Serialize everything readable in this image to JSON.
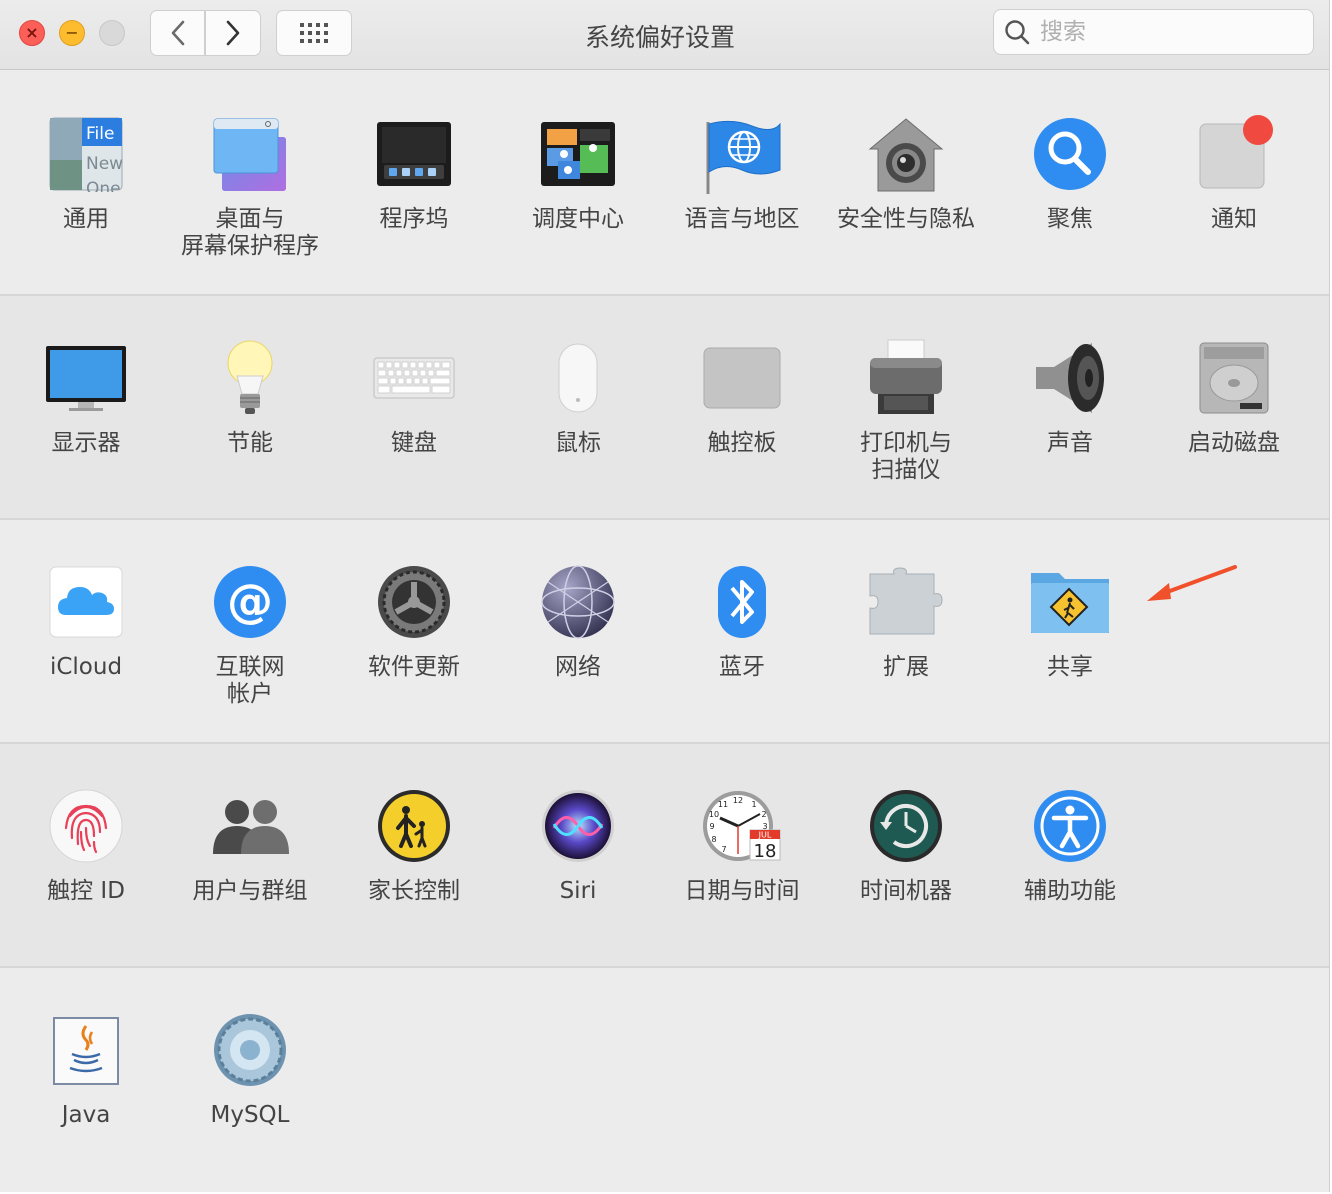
{
  "window": {
    "title": "系统偏好设置",
    "close_glyph": "×",
    "minimize_glyph": "−"
  },
  "toolbar": {
    "back_icon": "chevron-left-icon",
    "forward_icon": "chevron-right-icon",
    "grid_icon": "grid-icon",
    "search_placeholder": "搜索"
  },
  "rows": [
    {
      "items": [
        {
          "label": "通用",
          "icon": "general-icon",
          "icon_text": [
            "File",
            "New",
            "One"
          ]
        },
        {
          "label": "桌面与\n屏幕保护程序",
          "icon": "desktop-screensaver-icon"
        },
        {
          "label": "程序坞",
          "icon": "dock-icon"
        },
        {
          "label": "调度中心",
          "icon": "mission-control-icon"
        },
        {
          "label": "语言与地区",
          "icon": "language-region-icon"
        },
        {
          "label": "安全性与隐私",
          "icon": "security-privacy-icon"
        },
        {
          "label": "聚焦",
          "icon": "spotlight-icon"
        },
        {
          "label": "通知",
          "icon": "notifications-icon"
        }
      ]
    },
    {
      "items": [
        {
          "label": "显示器",
          "icon": "displays-icon"
        },
        {
          "label": "节能",
          "icon": "energy-saver-icon"
        },
        {
          "label": "键盘",
          "icon": "keyboard-icon"
        },
        {
          "label": "鼠标",
          "icon": "mouse-icon"
        },
        {
          "label": "触控板",
          "icon": "trackpad-icon"
        },
        {
          "label": "打印机与\n扫描仪",
          "icon": "printers-scanners-icon"
        },
        {
          "label": "声音",
          "icon": "sound-icon"
        },
        {
          "label": "启动磁盘",
          "icon": "startup-disk-icon"
        }
      ]
    },
    {
      "items": [
        {
          "label": "iCloud",
          "icon": "icloud-icon"
        },
        {
          "label": "互联网\n帐户",
          "icon": "internet-accounts-icon"
        },
        {
          "label": "软件更新",
          "icon": "software-update-icon"
        },
        {
          "label": "网络",
          "icon": "network-icon"
        },
        {
          "label": "蓝牙",
          "icon": "bluetooth-icon"
        },
        {
          "label": "扩展",
          "icon": "extensions-icon"
        },
        {
          "label": "共享",
          "icon": "sharing-icon"
        }
      ]
    },
    {
      "items": [
        {
          "label": "触控 ID",
          "icon": "touch-id-icon"
        },
        {
          "label": "用户与群组",
          "icon": "users-groups-icon"
        },
        {
          "label": "家长控制",
          "icon": "parental-controls-icon"
        },
        {
          "label": "Siri",
          "icon": "siri-icon"
        },
        {
          "label": "日期与时间",
          "icon": "date-time-icon",
          "icon_text": [
            "JUL",
            "18"
          ]
        },
        {
          "label": "时间机器",
          "icon": "time-machine-icon"
        },
        {
          "label": "辅助功能",
          "icon": "accessibility-icon"
        }
      ]
    },
    {
      "items": [
        {
          "label": "Java",
          "icon": "java-icon"
        },
        {
          "label": "MySQL",
          "icon": "mysql-icon"
        }
      ]
    }
  ],
  "annotation": {
    "icon": "red-arrow-icon",
    "color": "#f0502a"
  }
}
